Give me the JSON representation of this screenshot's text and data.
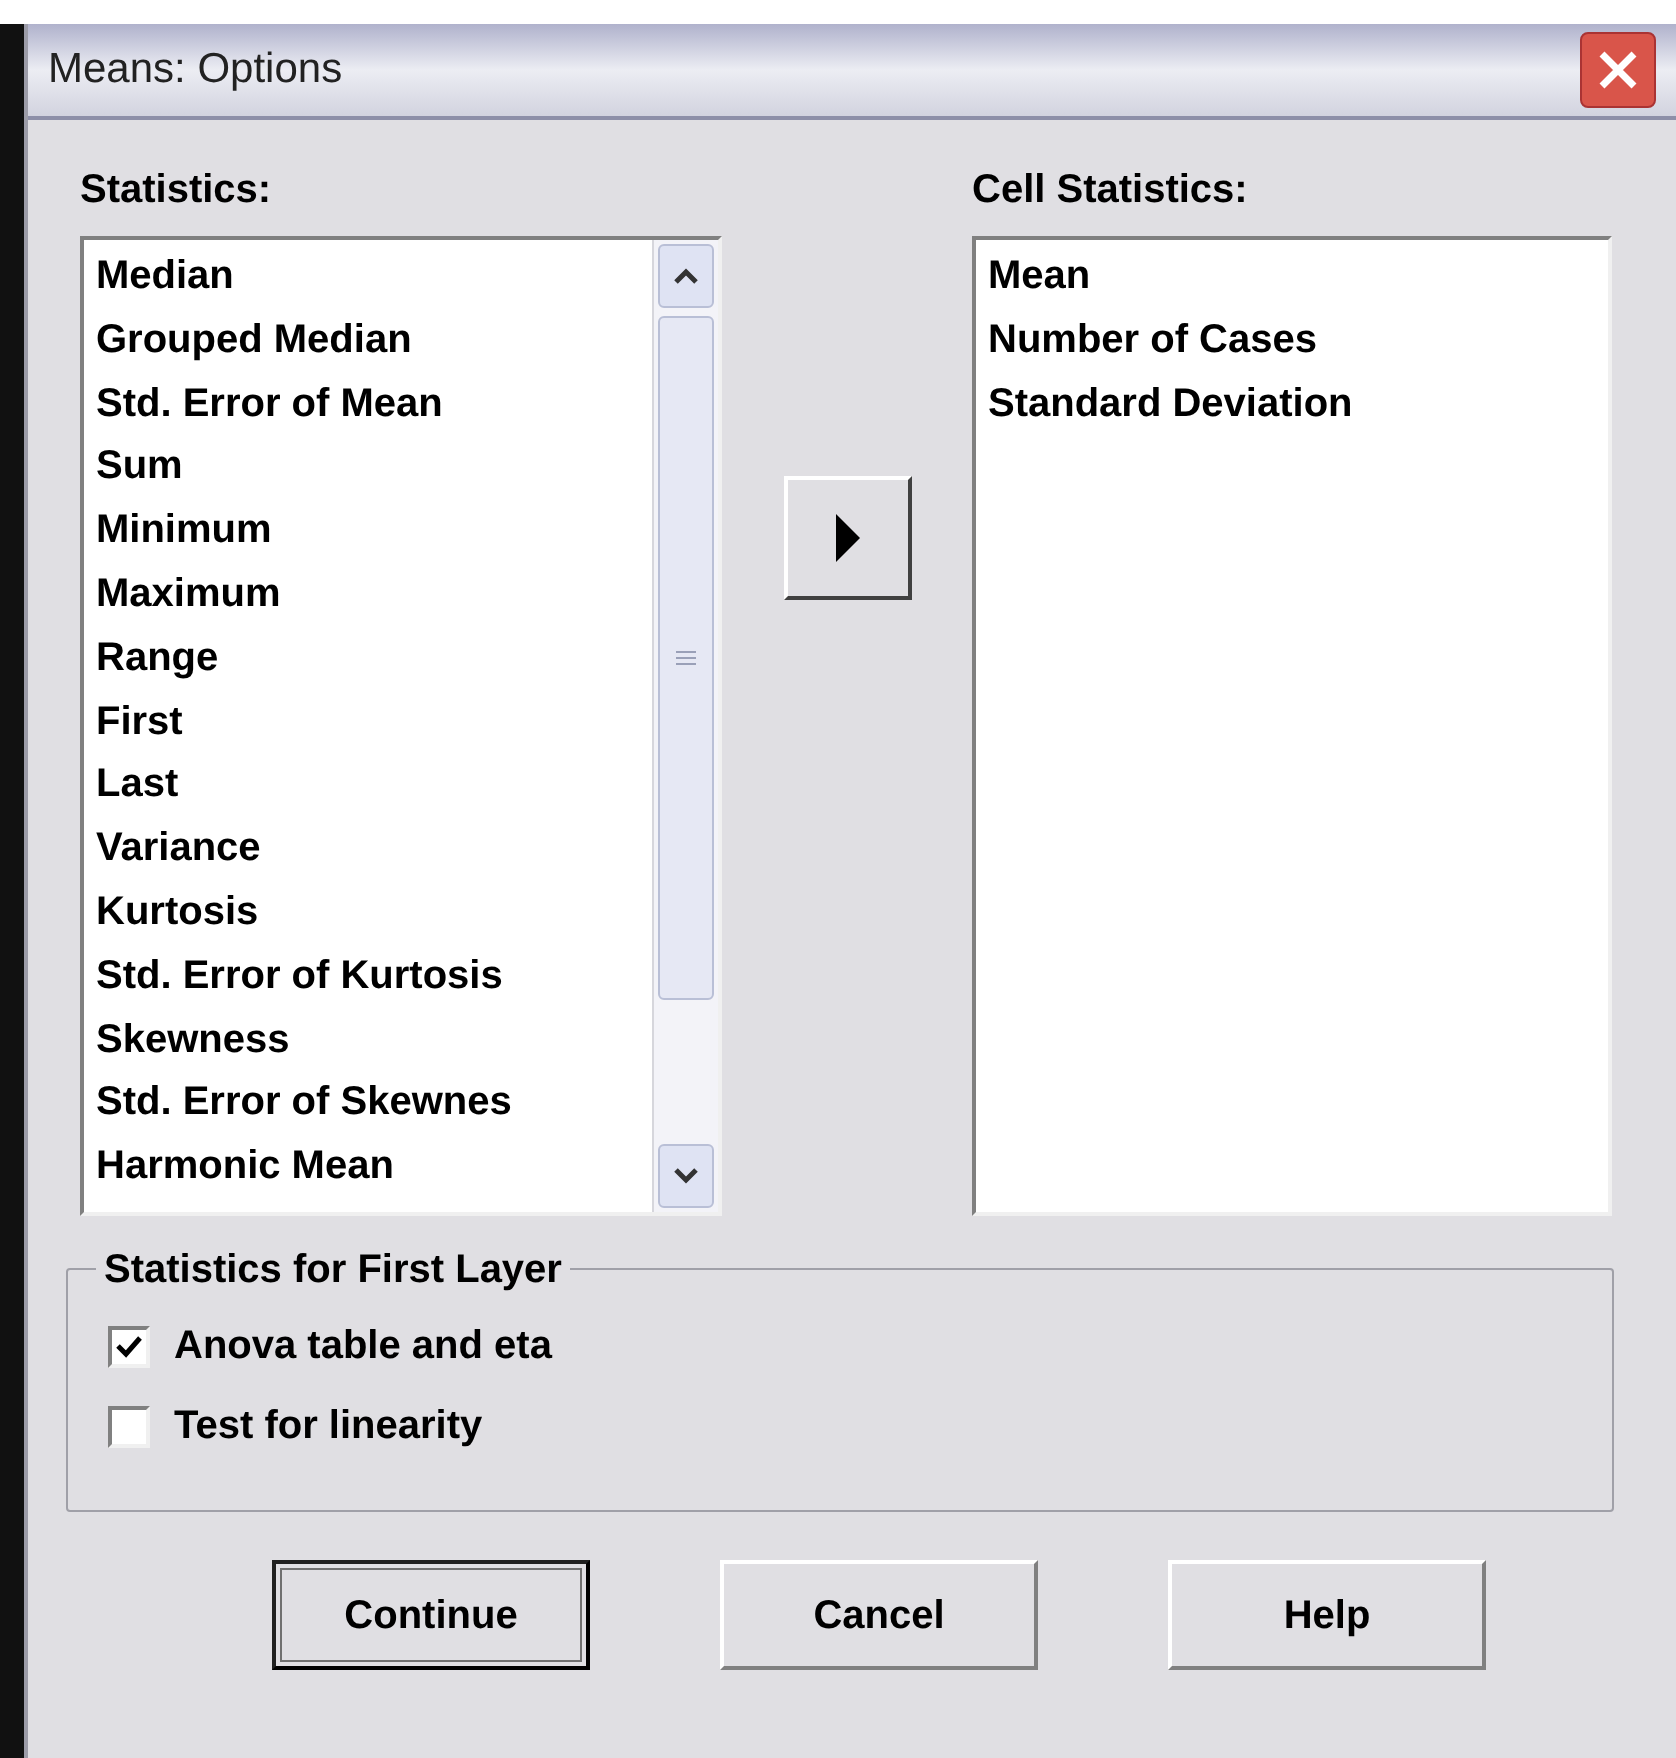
{
  "window": {
    "title": "Means: Options"
  },
  "statistics": {
    "label": "Statistics:",
    "items": [
      "Median",
      "Grouped Median",
      "Std. Error of Mean",
      "Sum",
      "Minimum",
      "Maximum",
      "Range",
      "First",
      "Last",
      "Variance",
      "Kurtosis",
      "Std. Error of Kurtosis",
      "Skewness",
      "Std. Error of Skewnes",
      "Harmonic Mean"
    ]
  },
  "cell_statistics": {
    "label": "Cell Statistics:",
    "items": [
      "Mean",
      "Number of Cases",
      "Standard Deviation"
    ]
  },
  "first_layer": {
    "title": "Statistics for First Layer",
    "options": [
      {
        "label": "Anova table and eta",
        "checked": true
      },
      {
        "label": "Test for linearity",
        "checked": false
      }
    ]
  },
  "buttons": [
    {
      "label": "Continue",
      "default": true
    },
    {
      "label": "Cancel",
      "default": false
    },
    {
      "label": "Help",
      "default": false
    }
  ]
}
